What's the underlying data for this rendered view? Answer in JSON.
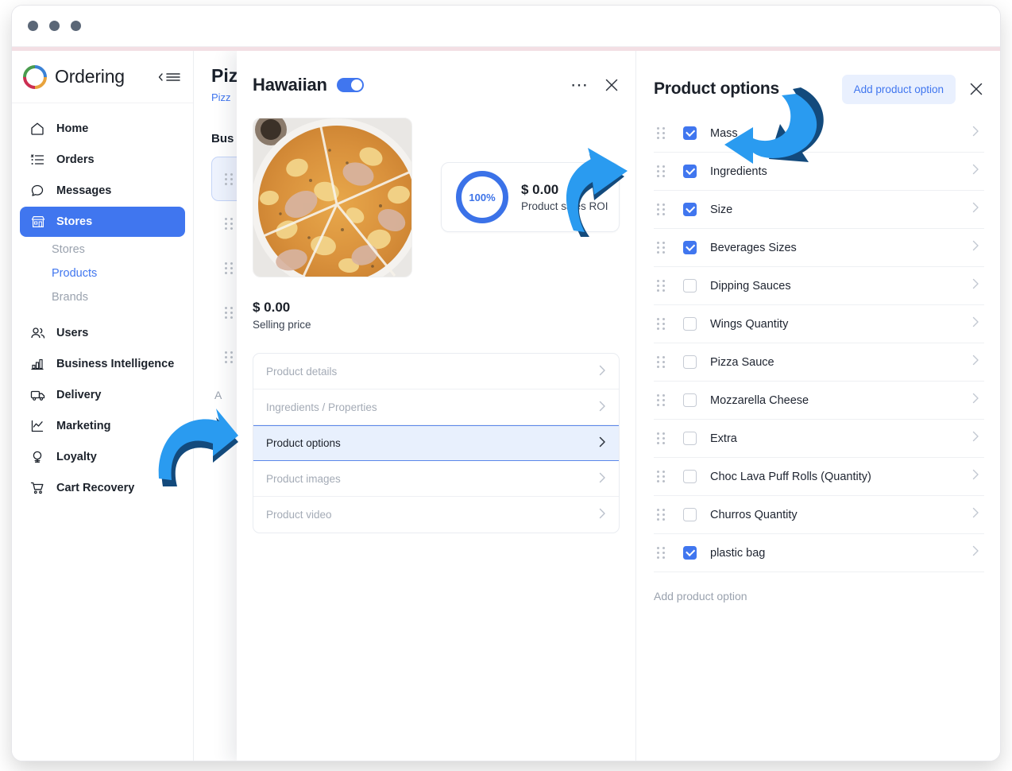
{
  "window": {
    "dots_count": 3
  },
  "sidebar": {
    "brand": "Ordering",
    "collapse_icon": "collapse-menu-icon",
    "items": [
      {
        "label": "Home",
        "icon": "home-icon",
        "active": false
      },
      {
        "label": "Orders",
        "icon": "list-icon",
        "active": false
      },
      {
        "label": "Messages",
        "icon": "chat-bubble-icon",
        "active": false
      },
      {
        "label": "Stores",
        "icon": "store-icon",
        "active": true
      }
    ],
    "subitems": [
      {
        "label": "Stores",
        "selected": false
      },
      {
        "label": "Products",
        "selected": true
      },
      {
        "label": "Brands",
        "selected": false
      }
    ],
    "items2": [
      {
        "label": "Users",
        "icon": "users-icon"
      },
      {
        "label": "Business Intelligence",
        "icon": "bar-chart-icon"
      },
      {
        "label": "Delivery",
        "icon": "truck-icon"
      },
      {
        "label": "Marketing",
        "icon": "line-chart-icon"
      },
      {
        "label": "Loyalty",
        "icon": "medal-icon"
      },
      {
        "label": "Cart Recovery",
        "icon": "cart-icon"
      }
    ]
  },
  "background_column": {
    "title": "Piz",
    "breadcrumb": "Pizz",
    "section": "Bus",
    "add_label": "A"
  },
  "product_modal": {
    "title": "Hawaiian",
    "enabled": true,
    "more_icon": "ellipsis-icon",
    "close_icon": "close-icon",
    "image_alt": "hawaiian-pizza-photo",
    "roi": {
      "percent": "100%",
      "amount": "$ 0.00",
      "label": "Product sales ROI"
    },
    "price": {
      "amount": "$ 0.00",
      "label": "Selling price"
    },
    "menu": [
      {
        "label": "Product details",
        "active": false
      },
      {
        "label": "Ingredients / Properties",
        "active": false
      },
      {
        "label": "Product options",
        "active": true
      },
      {
        "label": "Product images",
        "active": false
      },
      {
        "label": "Product video",
        "active": false
      }
    ]
  },
  "options_panel": {
    "title": "Product options",
    "add_button": "Add product option",
    "close_icon": "close-icon",
    "add_link": "Add product option",
    "options": [
      {
        "label": "Mass",
        "checked": true
      },
      {
        "label": "Ingredients",
        "checked": true
      },
      {
        "label": "Size",
        "checked": true
      },
      {
        "label": "Beverages Sizes",
        "checked": true
      },
      {
        "label": "Dipping Sauces",
        "checked": false
      },
      {
        "label": "Wings Quantity",
        "checked": false
      },
      {
        "label": "Pizza Sauce",
        "checked": false
      },
      {
        "label": "Mozzarella Cheese",
        "checked": false
      },
      {
        "label": "Extra",
        "checked": false
      },
      {
        "label": "Choc Lava Puff Rolls (Quantity)",
        "checked": false
      },
      {
        "label": "Churros Quantity",
        "checked": false
      },
      {
        "label": "plastic bag",
        "checked": true
      }
    ]
  },
  "annotations": {
    "arrows": [
      {
        "name": "arrow-to-product-options-menu",
        "points": "right"
      },
      {
        "name": "arrow-to-roi-card",
        "points": "right"
      },
      {
        "name": "arrow-to-add-product-option",
        "points": "left"
      }
    ]
  },
  "colors": {
    "accent_blue": "#4076ef",
    "arrow_blue": "#2a9bf0",
    "arrow_shadow": "#134a7c",
    "active_row_bg": "#e8f0fd",
    "muted_text": "#9aa2ae",
    "dark_text": "#1b2029",
    "pink_bar": "#f3dfe4"
  }
}
